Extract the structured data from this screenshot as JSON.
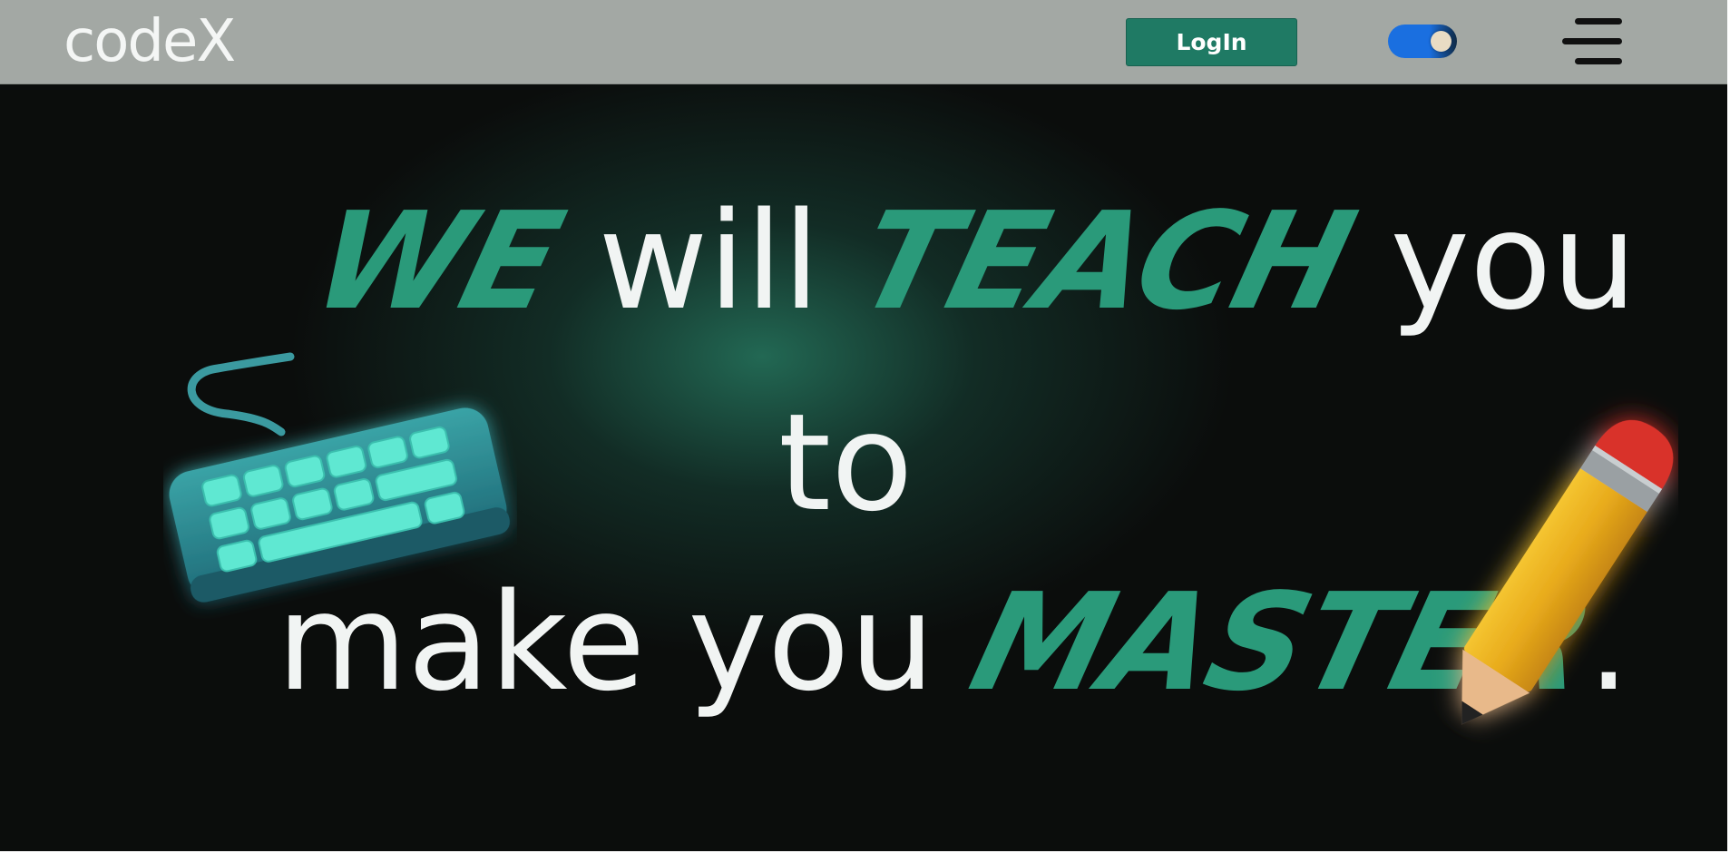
{
  "navbar": {
    "brand": "codeX",
    "login_label": "LogIn",
    "theme_toggle": {
      "state": "on",
      "color": "#1a6fe0"
    },
    "menu_icon": "hamburger-icon"
  },
  "hero": {
    "line1": {
      "accent1": "WE",
      "text1": " will ",
      "accent2": "TEACH",
      "text2": " you"
    },
    "line2": {
      "text": "to"
    },
    "line3": {
      "text": "make you ",
      "accent": "MASTER",
      "end": "."
    },
    "accent_color": "#2a9a7a",
    "illustrations": [
      "keyboard-icon",
      "pencil-icon"
    ]
  }
}
